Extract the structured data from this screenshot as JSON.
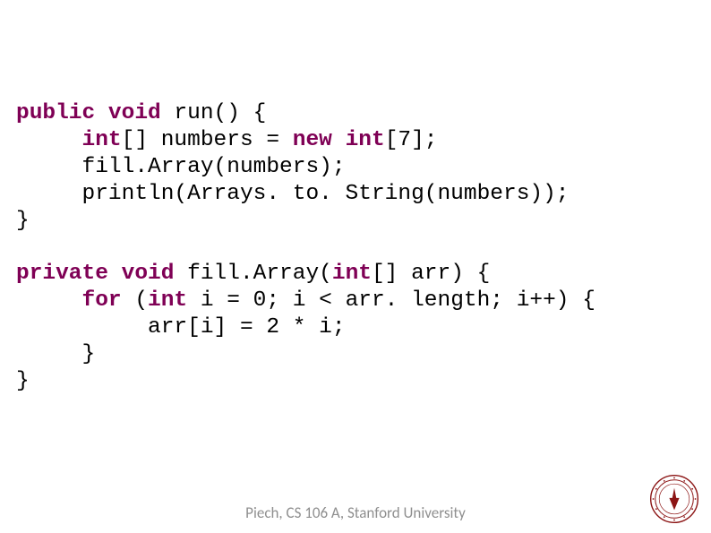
{
  "code": {
    "l1_kw1": "public",
    "l1_kw2": "void",
    "l1_rest": " run() {",
    "l2_indent": "     ",
    "l2_kw1": "int",
    "l2_mid": "[] numbers = ",
    "l2_kw2": "new",
    "l2_mid2": " ",
    "l2_kw3": "int",
    "l2_rest": "[7];",
    "l3": "     fill.Array(numbers);",
    "l4": "     println(Arrays. to. String(numbers));",
    "l5": "}",
    "l7_kw1": "private",
    "l7_kw2": "void",
    "l7_mid": " fill.Array(",
    "l7_kw3": "int",
    "l7_rest": "[] arr) {",
    "l8_indent": "     ",
    "l8_kw1": "for",
    "l8_mid": " (",
    "l8_kw2": "int",
    "l8_rest": " i = 0; i < arr. length; i++) {",
    "l9": "          arr[i] = 2 * i;",
    "l10": "     }",
    "l11": "}"
  },
  "footer": "Piech, CS 106 A, Stanford University",
  "seal_color": "#8c1515"
}
